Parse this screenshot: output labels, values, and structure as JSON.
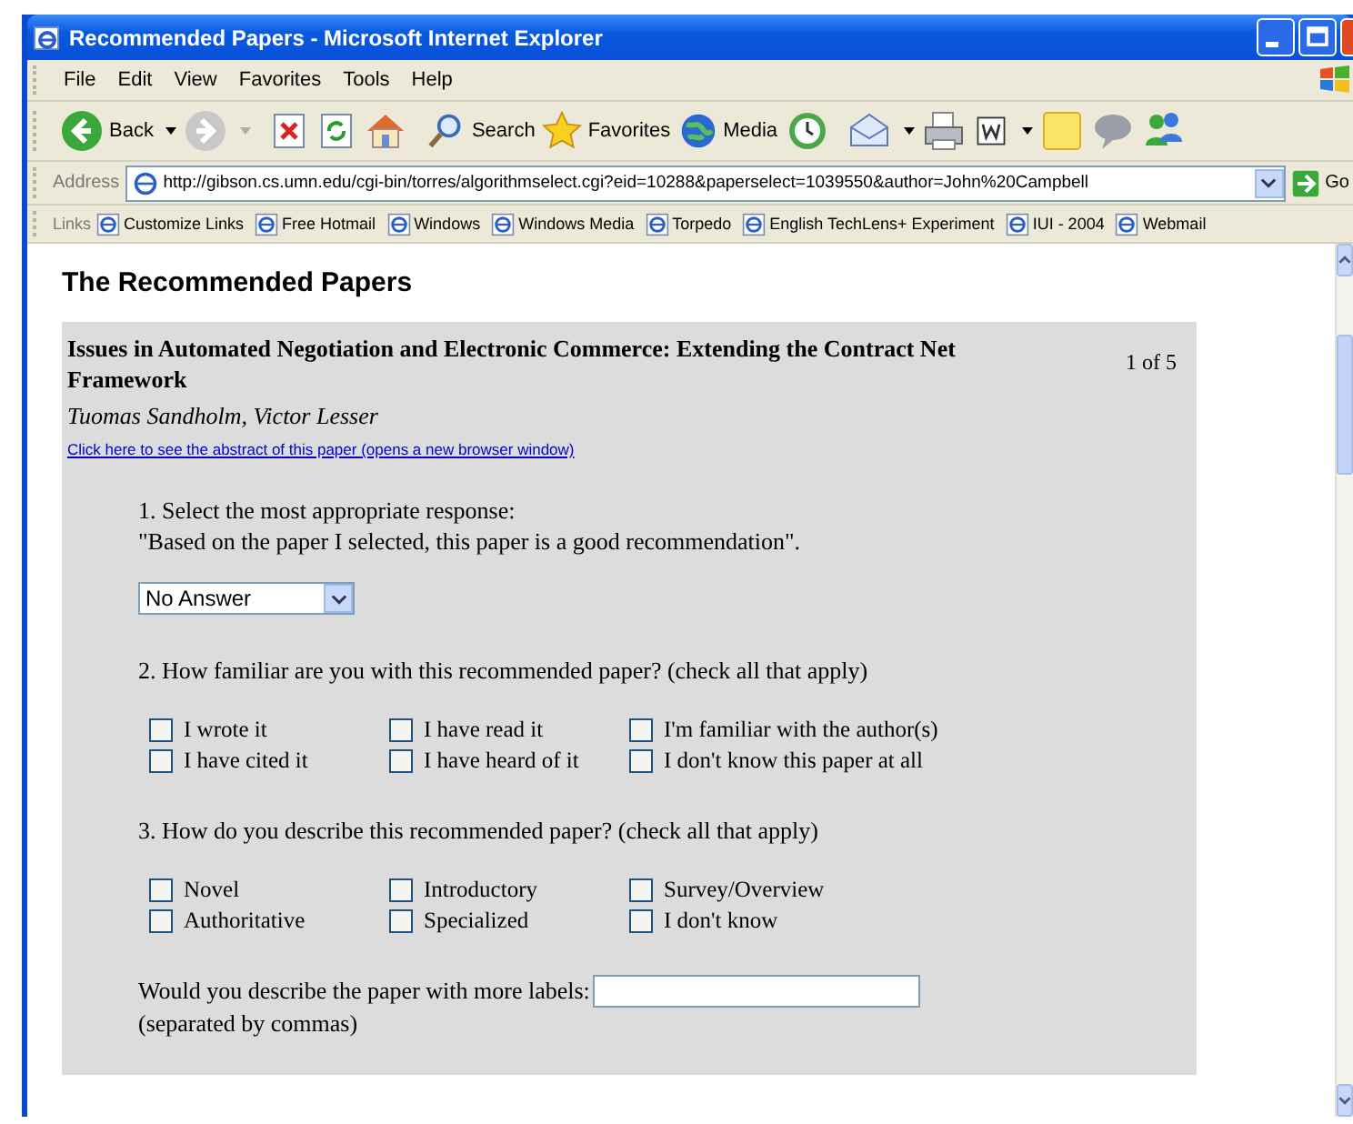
{
  "window": {
    "title": "Recommended Papers - Microsoft Internet Explorer"
  },
  "menu": [
    "File",
    "Edit",
    "View",
    "Favorites",
    "Tools",
    "Help"
  ],
  "toolbar": [
    {
      "kind": "back",
      "label": "Back"
    },
    {
      "kind": "forward"
    },
    {
      "kind": "stop"
    },
    {
      "kind": "refresh"
    },
    {
      "kind": "home"
    },
    {
      "kind": "search",
      "label": "Search"
    },
    {
      "kind": "favorites",
      "label": "Favorites"
    },
    {
      "kind": "media",
      "label": "Media"
    },
    {
      "kind": "history"
    },
    {
      "kind": "mail"
    },
    {
      "kind": "print"
    },
    {
      "kind": "edit"
    },
    {
      "kind": "notes"
    },
    {
      "kind": "discuss"
    },
    {
      "kind": "messenger"
    }
  ],
  "address": {
    "label": "Address",
    "url": "http://gibson.cs.umn.edu/cgi-bin/torres/algorithmselect.cgi?eid=10288&paperselect=1039550&author=John%20Campbell",
    "go": "Go"
  },
  "links": {
    "label": "Links",
    "items": [
      "Customize Links",
      "Free Hotmail",
      "Windows",
      "Windows Media",
      "Torpedo",
      "English TechLens+ Experiment",
      "IUI - 2004",
      "Webmail"
    ]
  },
  "page": {
    "heading": "The Recommended Papers",
    "paper": {
      "title": "Issues in Automated Negotiation and Electronic Commerce: Extending the Contract Net Framework",
      "counter": "1 of 5",
      "authors": "Tuomas Sandholm, Victor Lesser",
      "abstract_link": "Click here to see the abstract of this paper (opens a new browser window)"
    },
    "q1": {
      "prompt": "1. Select the most appropriate response:",
      "quote": "\"Based on the paper I selected, this paper is a good recommendation\".",
      "select_value": "No Answer"
    },
    "q2": {
      "prompt": "2. How familiar are you with this recommended paper? (check all that apply)",
      "options": [
        {
          "label": "I wrote it",
          "checked": false
        },
        {
          "label": "I have read it",
          "checked": false
        },
        {
          "label": "I'm familiar with the author(s)",
          "checked": false
        },
        {
          "label": "I have cited it",
          "checked": false
        },
        {
          "label": "I have heard of it",
          "checked": false
        },
        {
          "label": "I don't know this paper at all",
          "checked": false
        }
      ]
    },
    "q3": {
      "prompt": "3. How do you describe this recommended paper? (check all that apply)",
      "options": [
        {
          "label": "Novel",
          "checked": false
        },
        {
          "label": "Introductory",
          "checked": false
        },
        {
          "label": "Survey/Overview",
          "checked": false
        },
        {
          "label": "Authoritative",
          "checked": false
        },
        {
          "label": "Specialized",
          "checked": false
        },
        {
          "label": "I don't know",
          "checked": false
        }
      ]
    },
    "more_labels": {
      "label": "Would you describe the paper with more labels:",
      "hint": "(separated by commas)"
    }
  }
}
